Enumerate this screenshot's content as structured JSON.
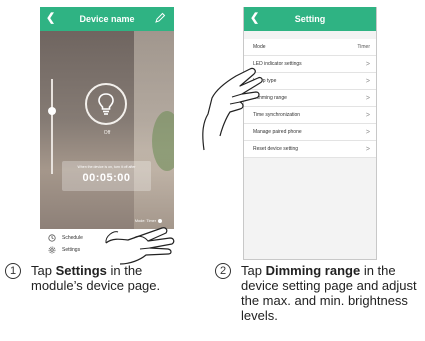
{
  "left_phone": {
    "title": "Device name",
    "bulb_state": "Off",
    "timer_caption": "When the device is on, turn it off after",
    "timer_value": "00:05:00",
    "mode_text": "Mode: Timer",
    "menu_items": [
      {
        "label": "Schedule",
        "icon": "clock-icon"
      },
      {
        "label": "Settings",
        "icon": "gear-icon"
      }
    ]
  },
  "right_phone": {
    "title": "Setting",
    "rows": [
      {
        "label": "Mode",
        "value": "Timer"
      },
      {
        "label": "LED indicator settings",
        "value": ">"
      },
      {
        "label": "Lamp type",
        "value": ">"
      },
      {
        "label": "Dimming range",
        "value": ">"
      },
      {
        "label": "Time synchronization",
        "value": ">"
      },
      {
        "label": "Manage paired phone",
        "value": ">"
      },
      {
        "label": "Reset device setting",
        "value": ">"
      }
    ]
  },
  "steps": [
    {
      "number": "1",
      "pre": "Tap ",
      "bold": "Settings",
      "post": " in the module’s device page."
    },
    {
      "number": "2",
      "pre": "Tap ",
      "bold": "Dimming range",
      "post": " in the device setting page and adjust the max. and min. brightness levels."
    }
  ],
  "colors": {
    "accent": "#2fb383"
  }
}
